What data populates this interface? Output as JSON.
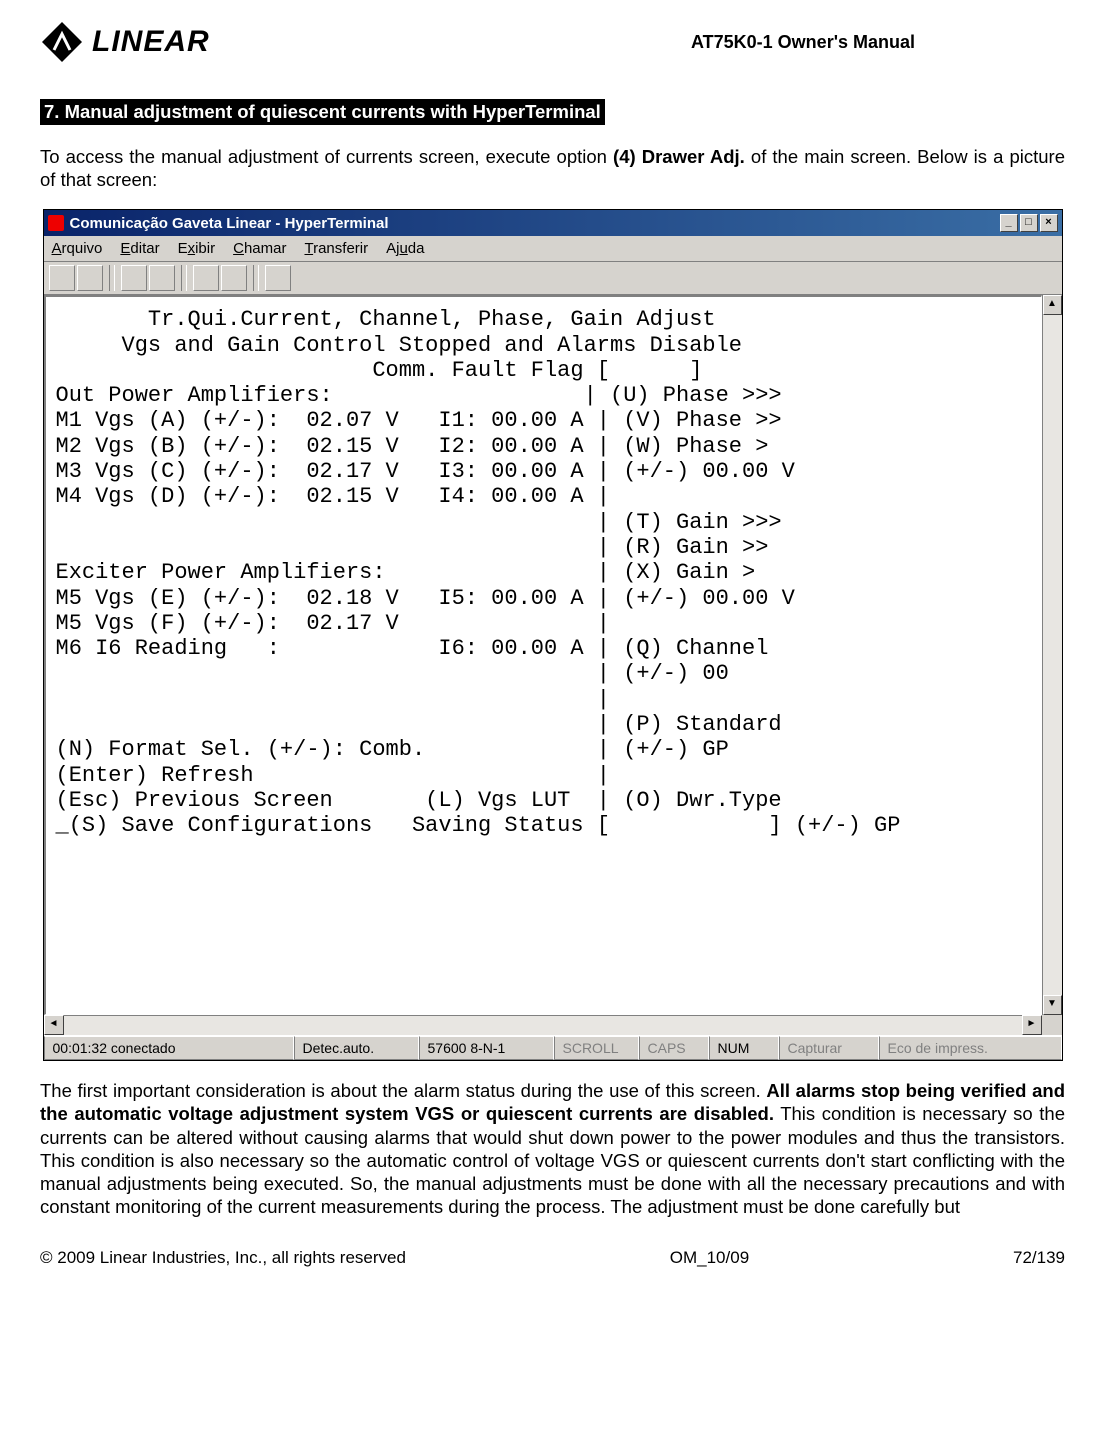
{
  "header": {
    "brand": "LINEAR",
    "manual_title": "AT75K0-1 Owner's Manual"
  },
  "section": {
    "heading": "7. Manual adjustment of quiescent currents with HyperTerminal",
    "intro_pre": "To access the manual adjustment of currents screen, execute option ",
    "intro_bold": "(4) Drawer Adj.",
    "intro_post": " of the main screen. Below is a picture of that screen:"
  },
  "window": {
    "title": "Comunicação Gaveta Linear - HyperTerminal",
    "menus": {
      "m1": "Arquivo",
      "m2": "Editar",
      "m3": "Exibir",
      "m4": "Chamar",
      "m5": "Transferir",
      "m6": "Ajuda"
    },
    "status": {
      "s1": "00:01:32 conectado",
      "s2": "Detec.auto.",
      "s3": "57600 8-N-1",
      "s4": "SCROLL",
      "s5": "CAPS",
      "s6": "NUM",
      "s7": "Capturar",
      "s8": "Eco de impress."
    }
  },
  "terminal_text": "       Tr.Qui.Current, Channel, Phase, Gain Adjust\n     Vgs and Gain Control Stopped and Alarms Disable\n                        Comm. Fault Flag [      ]\nOut Power Amplifiers:                   | (U) Phase >>>\nM1 Vgs (A) (+/-):  02.07 V   I1: 00.00 A | (V) Phase >>\nM2 Vgs (B) (+/-):  02.15 V   I2: 00.00 A | (W) Phase >\nM3 Vgs (C) (+/-):  02.17 V   I3: 00.00 A | (+/-) 00.00 V\nM4 Vgs (D) (+/-):  02.15 V   I4: 00.00 A |\n                                         | (T) Gain >>>\n                                         | (R) Gain >>\nExciter Power Amplifiers:                | (X) Gain >\nM5 Vgs (E) (+/-):  02.18 V   I5: 00.00 A | (+/-) 00.00 V\nM5 Vgs (F) (+/-):  02.17 V               |\nM6 I6 Reading   :            I6: 00.00 A | (Q) Channel\n                                         | (+/-) 00\n                                         |\n                                         | (P) Standard\n(N) Format Sel. (+/-): Comb.             | (+/-) GP\n(Enter) Refresh                          |\n(Esc) Previous Screen       (L) Vgs LUT  | (O) Dwr.Type\n_(S) Save Configurations   Saving Status [            ] (+/-) GP",
  "body": {
    "p1a": "The first important consideration is about the alarm status during the use of this screen. ",
    "p1b": "All alarms stop being verified and the automatic voltage adjustment system VGS or quiescent currents are disabled.",
    "p1c": " This condition is necessary so the currents can be altered without causing alarms that would shut down power to the power modules and thus the transistors. This condition is also necessary so the automatic control of voltage VGS or quiescent currents don't start conflicting with the manual adjustments being executed.  So, the manual adjustments must be done with all the necessary precautions and with constant monitoring of the current measurements during the process. The adjustment must be done carefully but"
  },
  "footer": {
    "left": "© 2009 Linear Industries, Inc., all rights reserved",
    "center": "OM_10/09",
    "right": "72/139"
  }
}
